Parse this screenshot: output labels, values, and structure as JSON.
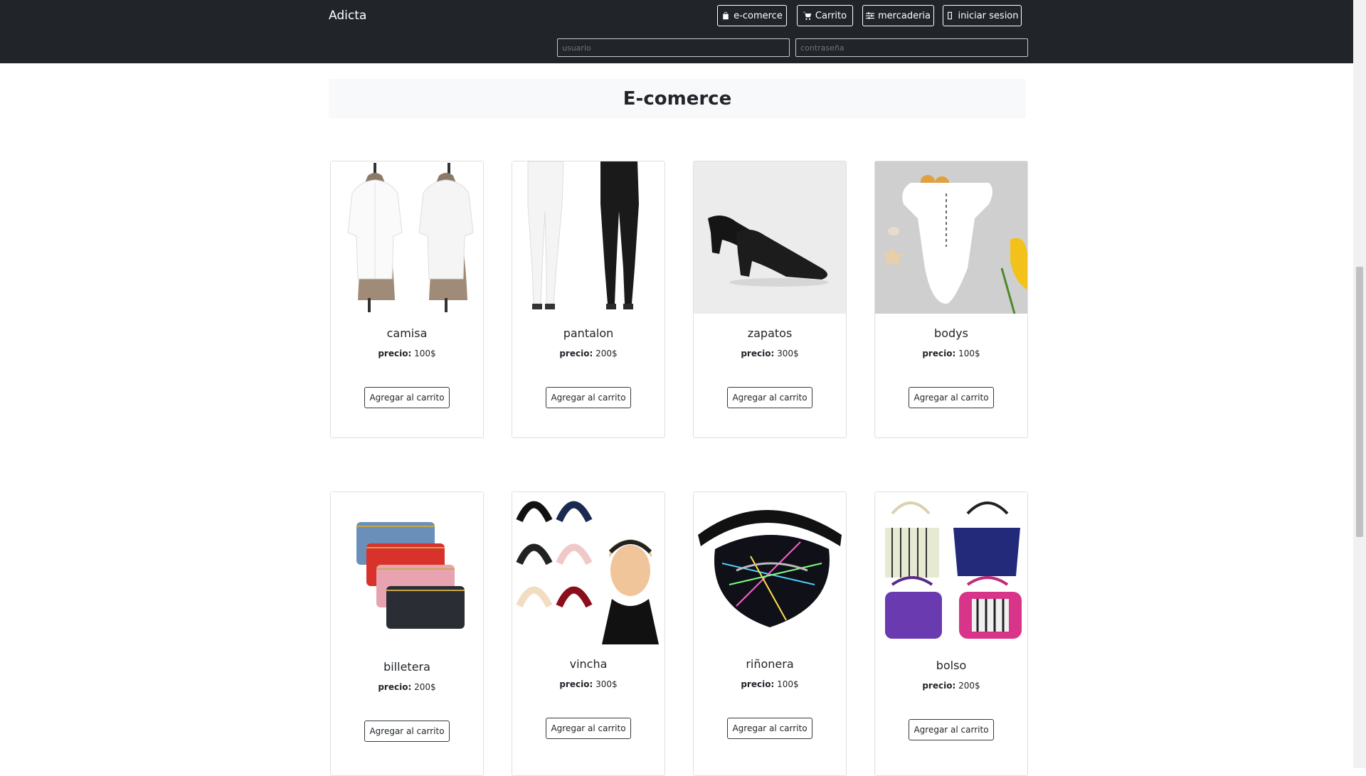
{
  "navbar": {
    "brand": "Adicta",
    "buttons": [
      {
        "label": "e-comerce",
        "icon": "bag-icon"
      },
      {
        "label": "Carrito",
        "icon": "cart-icon"
      },
      {
        "label": "mercaderia",
        "icon": "sliders-icon"
      },
      {
        "label": "iniciar sesion",
        "icon": "door-icon"
      }
    ],
    "login": {
      "user_placeholder": "usuario",
      "password_placeholder": "contraseña"
    }
  },
  "page": {
    "title": "E-comerce"
  },
  "price_label": "precio:",
  "add_button_label": "Agregar al carrito",
  "products": [
    {
      "name": "camisa",
      "price": "100$"
    },
    {
      "name": "pantalon",
      "price": "200$"
    },
    {
      "name": "zapatos",
      "price": "300$"
    },
    {
      "name": "bodys",
      "price": "100$"
    },
    {
      "name": "billetera",
      "price": "200$"
    },
    {
      "name": "vincha",
      "price": "300$"
    },
    {
      "name": "riñonera",
      "price": "100$"
    },
    {
      "name": "bolso",
      "price": "200$"
    }
  ],
  "colors": {
    "navbar_bg": "#212529",
    "jumbotron_bg": "#f8f9fa"
  }
}
